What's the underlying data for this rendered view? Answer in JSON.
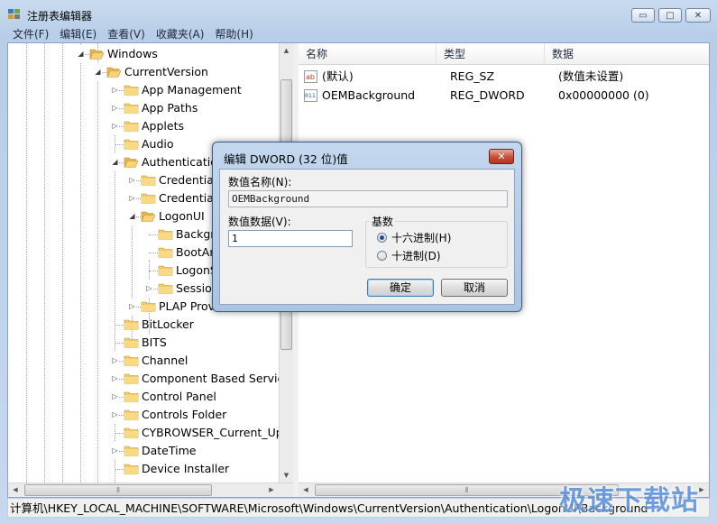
{
  "window": {
    "title": "注册表编辑器",
    "controls": {
      "minimize": "▭",
      "maximize": "□",
      "close": "✕"
    }
  },
  "menu": [
    "文件(F)",
    "编辑(E)",
    "查看(V)",
    "收藏夹(A)",
    "帮助(H)"
  ],
  "tree": [
    {
      "label": "Windows",
      "depth": 0,
      "expander": "◢",
      "open": true
    },
    {
      "label": "CurrentVersion",
      "depth": 1,
      "expander": "◢",
      "open": true
    },
    {
      "label": "App Management",
      "depth": 2,
      "expander": "▷"
    },
    {
      "label": "App Paths",
      "depth": 2,
      "expander": "▷"
    },
    {
      "label": "Applets",
      "depth": 2,
      "expander": "▷"
    },
    {
      "label": "Audio",
      "depth": 2,
      "expander": ""
    },
    {
      "label": "Authentication",
      "depth": 2,
      "expander": "◢",
      "open": true
    },
    {
      "label": "Credentials",
      "depth": 3,
      "expander": "▷"
    },
    {
      "label": "Credentials",
      "depth": 3,
      "expander": "▷"
    },
    {
      "label": "LogonUI",
      "depth": 3,
      "expander": "◢",
      "open": true
    },
    {
      "label": "Background",
      "depth": 4,
      "expander": "",
      "selected": true
    },
    {
      "label": "BootAnimation",
      "depth": 4,
      "expander": ""
    },
    {
      "label": "LogonSoundPlayed",
      "depth": 4,
      "expander": ""
    },
    {
      "label": "SessionData",
      "depth": 4,
      "expander": "▷"
    },
    {
      "label": "PLAP Providers",
      "depth": 3,
      "expander": "▷"
    },
    {
      "label": "BitLocker",
      "depth": 2,
      "expander": ""
    },
    {
      "label": "BITS",
      "depth": 2,
      "expander": ""
    },
    {
      "label": "Channel",
      "depth": 2,
      "expander": "▷"
    },
    {
      "label": "Component Based Servicing",
      "depth": 2,
      "expander": "▷"
    },
    {
      "label": "Control Panel",
      "depth": 2,
      "expander": "▷"
    },
    {
      "label": "Controls Folder",
      "depth": 2,
      "expander": "▷"
    },
    {
      "label": "CYBROWSER_Current_Update",
      "depth": 2,
      "expander": ""
    },
    {
      "label": "DateTime",
      "depth": 2,
      "expander": "▷"
    },
    {
      "label": "Device Installer",
      "depth": 2,
      "expander": ""
    }
  ],
  "list": {
    "columns": [
      "名称",
      "类型",
      "数据"
    ],
    "rows": [
      {
        "icon": "ab",
        "name": "(默认)",
        "type": "REG_SZ",
        "data": "(数值未设置)"
      },
      {
        "icon": "011",
        "name": "OEMBackground",
        "type": "REG_DWORD",
        "data": "0x00000000 (0)"
      }
    ]
  },
  "scroll": {
    "up": "▲",
    "down": "▼",
    "left": "◀",
    "right": "▶",
    "grip": "⦀"
  },
  "status": "计算机\\HKEY_LOCAL_MACHINE\\SOFTWARE\\Microsoft\\Windows\\CurrentVersion\\Authentication\\LogonUI\\Background",
  "watermark": "极速下载站",
  "dialog": {
    "title": "编辑 DWORD (32 位)值",
    "close": "✕",
    "name_label": "数值名称(N):",
    "name_value": "OEMBackground",
    "data_label": "数值数据(V):",
    "data_value": "1",
    "base_label": "基数",
    "hex_label": "十六进制(H)",
    "dec_label": "十进制(D)",
    "ok": "确定",
    "cancel": "取消"
  },
  "colors": {
    "accent": "#3c7fb1",
    "titlebar": "#c9dbef",
    "watermark": "#5a8fd8"
  }
}
